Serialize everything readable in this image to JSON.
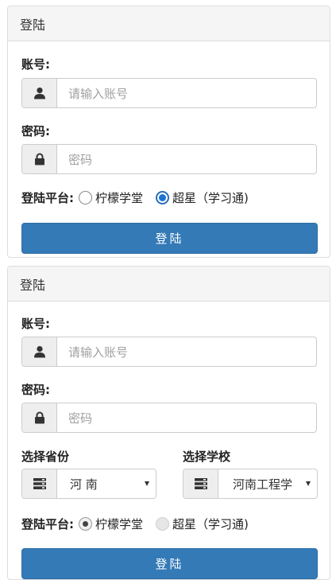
{
  "top_form": {
    "heading": "登陆",
    "account_label": "账号:",
    "account_placeholder": "请输入账号",
    "password_label": "密码:",
    "password_placeholder": "密码",
    "platform_label": "登陆平台:",
    "platform_options": [
      "柠檬学堂",
      "超星（学习通)"
    ],
    "selected_option": "超星（学习通)",
    "submit_label": "登陆"
  },
  "bottom_form": {
    "heading": "登陆",
    "account_label": "账号:",
    "account_placeholder": "请输入账号",
    "password_label": "密码:",
    "password_placeholder": "密码",
    "province_label": "选择省份",
    "province_value": "河 南",
    "school_label": "选择学校",
    "school_value": "河南工程学",
    "platform_label": "登陆平台:",
    "platform_options": [
      "柠檬学堂",
      "超星（学习通)"
    ],
    "selected_option": "柠檬学堂",
    "submit_label": "登陆"
  },
  "icons": {
    "account": "user-icon",
    "password": "lock-icon",
    "select": "server-list-icon",
    "dropdown": "caret-down-icon"
  },
  "colors": {
    "primary_button": "#337ab7",
    "radio_selected": "#1d72d2",
    "panel_heading_bg": "#f5f5f5"
  }
}
